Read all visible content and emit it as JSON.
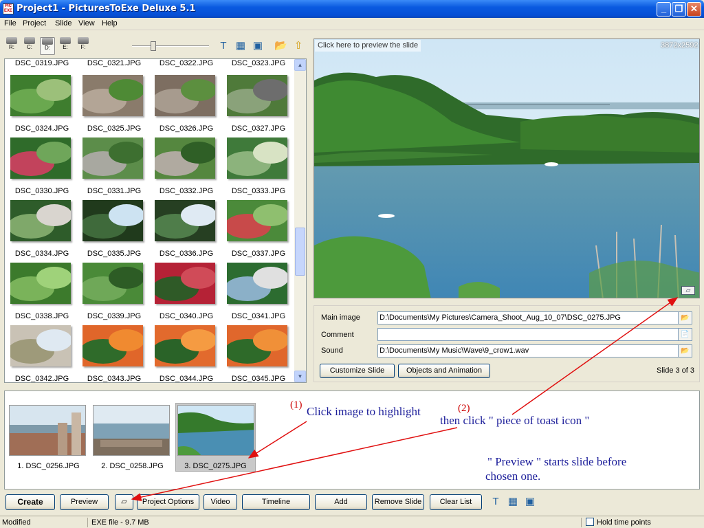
{
  "window": {
    "title": "Project1 - PicturesToExe Deluxe 5.1",
    "app_icon_text": "PIC EXE"
  },
  "menu": [
    "File",
    "Project",
    "Slide",
    "View",
    "Help"
  ],
  "drives": [
    "R:",
    "C:",
    "D:",
    "E:",
    "F:"
  ],
  "grid": {
    "top_row": [
      "DSC_0319.JPG",
      "DSC_0321.JPG",
      "DSC_0322.JPG",
      "DSC_0323.JPG"
    ],
    "rows": [
      [
        "DSC_0324.JPG",
        "DSC_0325.JPG",
        "DSC_0326.JPG",
        "DSC_0327.JPG"
      ],
      [
        "DSC_0330.JPG",
        "DSC_0331.JPG",
        "DSC_0332.JPG",
        "DSC_0333.JPG"
      ],
      [
        "DSC_0334.JPG",
        "DSC_0335.JPG",
        "DSC_0336.JPG",
        "DSC_0337.JPG"
      ],
      [
        "DSC_0338.JPG",
        "DSC_0339.JPG",
        "DSC_0340.JPG",
        "DSC_0341.JPG"
      ],
      [
        "DSC_0342.JPG",
        "DSC_0343.JPG",
        "DSC_0344.JPG",
        "DSC_0345.JPG"
      ]
    ]
  },
  "preview": {
    "link": "Click here to preview the slide",
    "resolution": "3872x2592"
  },
  "props": {
    "main_image_label": "Main image",
    "main_image": "D:\\Documents\\My Pictures\\Camera_Shoot_Aug_10_07\\DSC_0275.JPG",
    "comment_label": "Comment",
    "comment": "",
    "sound_label": "Sound",
    "sound": "D:\\Documents\\My Music\\Wave\\9_crow1.wav",
    "customize": "Customize Slide",
    "objects": "Objects and Animation",
    "slide_count": "Slide 3 of 3"
  },
  "strip": [
    "1. DSC_0256.JPG",
    "2. DSC_0258.JPG",
    "3. DSC_0275.JPG"
  ],
  "annotations": {
    "n1": "(1)",
    "t1": "Click image to highlight",
    "n2": "(2)",
    "t2": "then click \" piece of toast icon \"",
    "t3a": "\" Preview \" starts slide before",
    "t3b": "chosen one."
  },
  "buttons": {
    "create": "Create",
    "preview": "Preview",
    "project_options": "Project Options",
    "video": "Video",
    "timeline": "Timeline",
    "add": "Add",
    "remove": "Remove Slide",
    "clear": "Clear List"
  },
  "status": {
    "modified": "Modified",
    "exe": "EXE file - 9.7 MB",
    "hold": "Hold time points"
  }
}
